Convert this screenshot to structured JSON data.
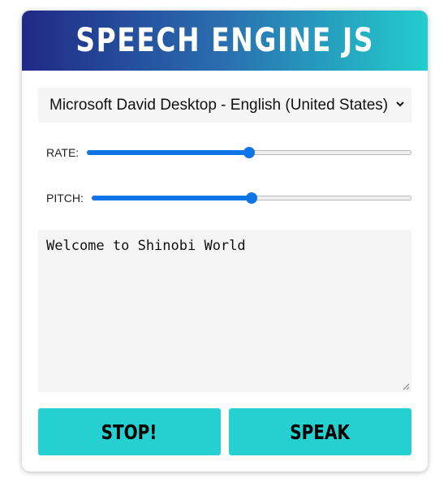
{
  "header": {
    "title": "SPEECH ENGINE JS"
  },
  "voice": {
    "selected": "Microsoft David Desktop - English (United States)"
  },
  "rate": {
    "label": "RATE:",
    "value": 0.5
  },
  "pitch": {
    "label": "PITCH:",
    "value": 0.5
  },
  "message": {
    "text": "Welcome to Shinobi World"
  },
  "buttons": {
    "stop_label": "STOP!",
    "speak_label": "SPEAK"
  },
  "colors": {
    "accent": "#25d0d0",
    "slider": "#0e74e8",
    "header_start": "#1f2a86",
    "header_end": "#22cdcd"
  }
}
